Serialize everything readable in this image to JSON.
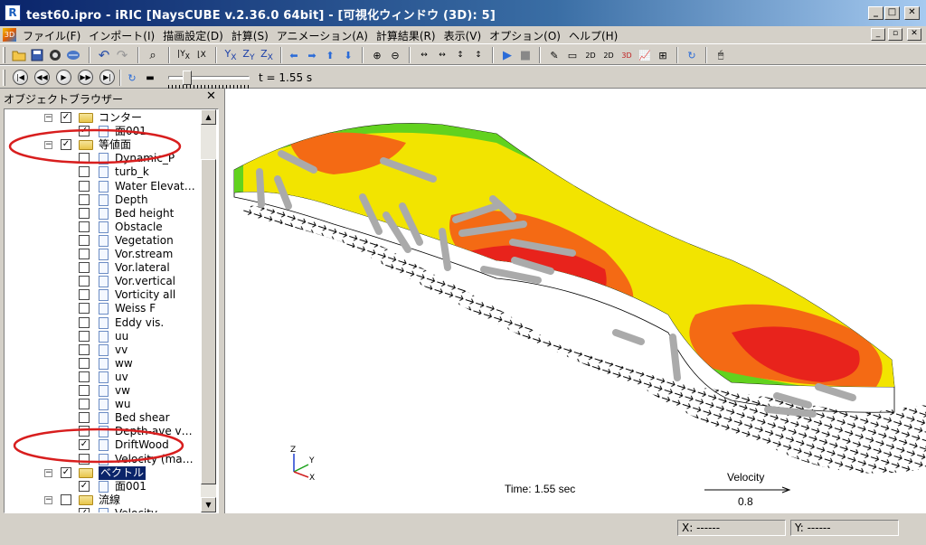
{
  "window": {
    "title": "test60.ipro - iRIC [NaysCUBE v.2.36.0 64bit] - [可視化ウィンドウ (3D): 5]",
    "app_icon": "iric-logo-icon"
  },
  "menu": [
    "ファイル(F)",
    "インポート(I)",
    "描画設定(D)",
    "計算(S)",
    "アニメーション(A)",
    "計算結果(R)",
    "表示(V)",
    "オプション(O)",
    "ヘルプ(H)"
  ],
  "animation": {
    "time_label": "t = 1.55 s",
    "progress": 0.2
  },
  "object_browser": {
    "title": "オブジェクトブラウザー",
    "nodes": [
      {
        "label": "コンター",
        "type": "folder",
        "checked": true,
        "level": 1,
        "expanded": true
      },
      {
        "label": "面001",
        "type": "item",
        "checked": true,
        "level": 2
      },
      {
        "label": "等値面",
        "type": "folder",
        "checked": true,
        "level": 1,
        "expanded": true
      },
      {
        "label": "Dynamic_P",
        "type": "item",
        "checked": false,
        "level": 2
      },
      {
        "label": "turb_k",
        "type": "item",
        "checked": false,
        "level": 2
      },
      {
        "label": "Water Elevat…",
        "type": "item",
        "checked": false,
        "level": 2
      },
      {
        "label": "Depth",
        "type": "item",
        "checked": false,
        "level": 2
      },
      {
        "label": "Bed height",
        "type": "item",
        "checked": false,
        "level": 2
      },
      {
        "label": "Obstacle",
        "type": "item",
        "checked": false,
        "level": 2
      },
      {
        "label": "Vegetation",
        "type": "item",
        "checked": false,
        "level": 2
      },
      {
        "label": "Vor.stream",
        "type": "item",
        "checked": false,
        "level": 2
      },
      {
        "label": "Vor.lateral",
        "type": "item",
        "checked": false,
        "level": 2
      },
      {
        "label": "Vor.vertical",
        "type": "item",
        "checked": false,
        "level": 2
      },
      {
        "label": "Vorticity all",
        "type": "item",
        "checked": false,
        "level": 2
      },
      {
        "label": "Weiss F",
        "type": "item",
        "checked": false,
        "level": 2
      },
      {
        "label": "Eddy vis.",
        "type": "item",
        "checked": false,
        "level": 2
      },
      {
        "label": "uu",
        "type": "item",
        "checked": false,
        "level": 2
      },
      {
        "label": "vv",
        "type": "item",
        "checked": false,
        "level": 2
      },
      {
        "label": "ww",
        "type": "item",
        "checked": false,
        "level": 2
      },
      {
        "label": "uv",
        "type": "item",
        "checked": false,
        "level": 2
      },
      {
        "label": "vw",
        "type": "item",
        "checked": false,
        "level": 2
      },
      {
        "label": "wu",
        "type": "item",
        "checked": false,
        "level": 2
      },
      {
        "label": "Bed shear",
        "type": "item",
        "checked": false,
        "level": 2
      },
      {
        "label": "Depth-ave v…",
        "type": "item",
        "checked": false,
        "level": 2
      },
      {
        "label": "DriftWood",
        "type": "item",
        "checked": true,
        "level": 2
      },
      {
        "label": "Velocity (ma…",
        "type": "item",
        "checked": false,
        "level": 2
      },
      {
        "label": "ベクトル",
        "type": "folder",
        "checked": true,
        "level": 1,
        "expanded": true,
        "selected": true
      },
      {
        "label": "面001",
        "type": "item",
        "checked": true,
        "level": 2
      },
      {
        "label": "流線",
        "type": "folder",
        "checked": false,
        "level": 1,
        "expanded": true
      },
      {
        "label": "Velocity",
        "type": "item",
        "checked": true,
        "level": 2
      }
    ]
  },
  "view3d": {
    "time_text": "Time:  1.55 sec",
    "legend_title": "Velocity",
    "legend_value": "0.8",
    "axes": {
      "x": "X",
      "y": "Y",
      "z": "Z"
    },
    "colors": {
      "red": "#e8231c",
      "orange": "#f46a14",
      "yellow": "#f2e400",
      "green": "#62d21e",
      "cyan": "#36c6d8",
      "wood": "#aaaaaa",
      "annotation": "#d81e1e"
    }
  },
  "status": {
    "x": "X: ------",
    "y": "Y: ------"
  }
}
